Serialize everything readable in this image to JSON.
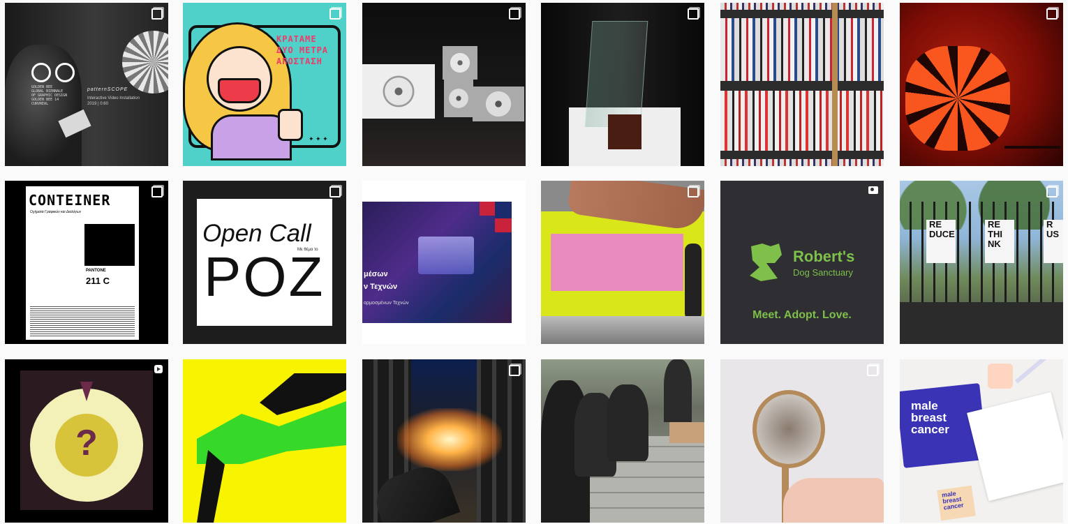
{
  "grid": {
    "posts": [
      {
        "name": "post-golden-bee",
        "badge": "multi",
        "lines": [
          "GOLDEN BEE",
          "GLOBAL BIENNALE",
          "OF GRAPHIC DESIGN",
          "GOLDEN BEE 14",
          "CURVREAL"
        ],
        "brand": "patternSCOPE",
        "caption1": "Interactive Video Installation",
        "caption2": "2019 | 0:60"
      },
      {
        "name": "post-illustration-distance",
        "badge": "multi",
        "text": "ΚΡΑΤΑΜΕ ΔΥΟ ΜΕΤΡΑ ΑΠΟΣΤΑΣΗ",
        "stars": "✦ ✦ ✦"
      },
      {
        "name": "post-projection-boxes",
        "badge": "multi"
      },
      {
        "name": "post-award-trophy",
        "badge": "multi"
      },
      {
        "name": "post-bookshelf"
      },
      {
        "name": "post-lamp",
        "badge": "multi"
      },
      {
        "name": "post-container-poster",
        "badge": "multi",
        "title": "CONTEINER",
        "subtitle": "Οχήματα Γραφικών και Διαλόγων",
        "pantone_label": "PANTONE",
        "pantone_code": "211 C"
      },
      {
        "name": "post-open-call",
        "badge": "multi",
        "line1": "Open Call",
        "small": "Με θέμα το",
        "line2": "POZ"
      },
      {
        "name": "post-applied-arts",
        "line1": "μέσων",
        "line2": "ν Τεχνών",
        "line3": "αρμοσμένων Τεχνών"
      },
      {
        "name": "post-screen-printing",
        "badge": "multi"
      },
      {
        "name": "post-roberts-dog-sanctuary",
        "badge": "camera",
        "brand_line1": "Robert's",
        "brand_line2": "Dog Sanctuary",
        "tagline": "Meet. Adopt. Love."
      },
      {
        "name": "post-reduce-rethink",
        "badge": "multi",
        "sign1": [
          "RE",
          "DUCE"
        ],
        "sign2": [
          "RE",
          "THI",
          "NK"
        ],
        "sign3": [
          "R",
          "US"
        ]
      },
      {
        "name": "post-question-game",
        "badge": "reel",
        "symbol": "?"
      },
      {
        "name": "post-yellow-green-abstract"
      },
      {
        "name": "post-game-corridor",
        "badge": "multi"
      },
      {
        "name": "post-photographers"
      },
      {
        "name": "post-magnifier",
        "badge": "multi"
      },
      {
        "name": "post-male-breast-cancer",
        "text_lines": [
          "male",
          "breast",
          "cancer"
        ],
        "small_lines": [
          "male",
          "breast",
          "cancer"
        ]
      }
    ]
  },
  "colors": {
    "illus_bg": "#4fd0c8",
    "dog_green": "#7ec04a",
    "dog_bg": "#2e2e33",
    "question_bg": "#2b1a1f",
    "question_disc": "#f3f0b8",
    "question_inner": "#d8c43a",
    "question_mark": "#6b2a4a",
    "cancer_blue": "#3a33b5"
  }
}
